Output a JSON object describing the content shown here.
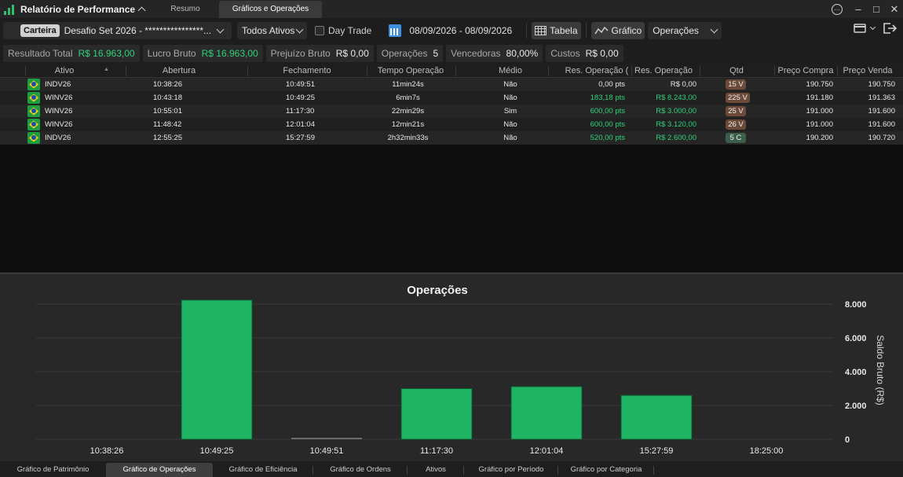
{
  "window": {
    "title": "Relatório de Performance",
    "tabs": [
      "Resumo",
      "Gráficos e Operações"
    ],
    "controls": [
      "…",
      "–",
      "□",
      "✕"
    ]
  },
  "toolbar": {
    "carteira_label": "Carteira",
    "carteira_value": "Desafio Set 2026 - ****************...",
    "ativos": "Todos Ativos",
    "daytrade": "Day Trade",
    "daterange": "08/09/2026 - 08/09/2026",
    "tabela": "Tabela",
    "grafico": "Gráfico",
    "tipo": "Operações"
  },
  "summary": [
    {
      "label": "Resultado Total",
      "value": "R$ 16.963,00",
      "green": true
    },
    {
      "label": "Lucro Bruto",
      "value": "R$ 16.963,00",
      "green": true
    },
    {
      "label": "Prejuízo Bruto",
      "value": "R$ 0,00",
      "green": false
    },
    {
      "label": "Operações",
      "value": "5",
      "green": false
    },
    {
      "label": "Vencedoras",
      "value": "80,00%",
      "green": false
    },
    {
      "label": "Custos",
      "value": "R$ 0,00",
      "green": false
    }
  ],
  "table": {
    "columns": [
      "Ativo",
      "Abertura",
      "Fechamento",
      "Tempo Operação",
      "Médio",
      "Res. Operação (",
      "Res. Operação",
      "Qtd",
      "Preço Compra",
      "Preço Venda"
    ],
    "rows": [
      {
        "ativo": "INDV26",
        "abertura": "10:38:26",
        "fechamento": "10:49:51",
        "tempo": "11min24s",
        "medio": "Não",
        "res_pts": "0,00 pts",
        "res_brl": "R$ 0,00",
        "qtd": "15 V",
        "compra": "190.750",
        "venda": "190.750",
        "positive": false
      },
      {
        "ativo": "WINV26",
        "abertura": "10:43:18",
        "fechamento": "10:49:25",
        "tempo": "6min7s",
        "medio": "Não",
        "res_pts": "183,18 pts",
        "res_brl": "R$ 8.243,00",
        "qtd": "225 V",
        "compra": "191.180",
        "venda": "191.363",
        "positive": true
      },
      {
        "ativo": "WINV26",
        "abertura": "10:55:01",
        "fechamento": "11:17:30",
        "tempo": "22min29s",
        "medio": "Sim",
        "res_pts": "600,00 pts",
        "res_brl": "R$ 3.000,00",
        "qtd": "25 V",
        "compra": "191.000",
        "venda": "191.600",
        "positive": true
      },
      {
        "ativo": "WINV26",
        "abertura": "11:48:42",
        "fechamento": "12:01:04",
        "tempo": "12min21s",
        "medio": "Não",
        "res_pts": "600,00 pts",
        "res_brl": "R$ 3.120,00",
        "qtd": "26 V",
        "compra": "191.000",
        "venda": "191.600",
        "positive": true
      },
      {
        "ativo": "INDV26",
        "abertura": "12:55:25",
        "fechamento": "15:27:59",
        "tempo": "2h32min33s",
        "medio": "Não",
        "res_pts": "520,00 pts",
        "res_brl": "R$ 2.600,00",
        "qtd": "5 C",
        "compra": "190.200",
        "venda": "190.720",
        "positive": true
      }
    ]
  },
  "chart_data": {
    "type": "bar",
    "title": "Operações",
    "ylabel": "Saldo Bruto (R$)",
    "categories": [
      "10:38:26",
      "10:49:25",
      "10:49:51",
      "11:17:30",
      "12:01:04",
      "15:27:59",
      "18:25:00"
    ],
    "values": [
      null,
      8243,
      0,
      3000,
      3120,
      2600,
      null
    ],
    "yticks": [
      "0",
      "2.000",
      "4.000",
      "6.000",
      "8.000"
    ],
    "ylim": [
      0,
      8000
    ],
    "grid": true,
    "colors": {
      "bar": "#1fb463",
      "bar_border": "#0e5a30",
      "zero_bar": "#6a6a6a"
    }
  },
  "bottom_tabs": [
    "Gráfico de Patrimônio",
    "Gráfico de Operações",
    "Gráfico de Eficiência",
    "Gráfico de Ordens",
    "Ativos",
    "Gráfico por Período",
    "Gráfico por Categoria"
  ],
  "active_bottom_tab": 1
}
